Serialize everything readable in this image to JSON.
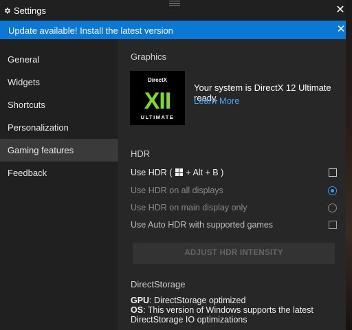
{
  "window": {
    "title": "Settings"
  },
  "banner": {
    "text": "Update available! Install the latest version"
  },
  "sidebar": {
    "items": [
      {
        "label": "General"
      },
      {
        "label": "Widgets"
      },
      {
        "label": "Shortcuts"
      },
      {
        "label": "Personalization"
      },
      {
        "label": "Gaming features",
        "active": true
      },
      {
        "label": "Feedback"
      }
    ]
  },
  "graphics": {
    "heading": "Graphics",
    "logo": {
      "top": "DirectX",
      "mark": "XII",
      "bottom": "ULTIMATE"
    },
    "status": "Your system is DirectX 12 Ultimate ready.",
    "learn_more": "Learn More"
  },
  "hdr": {
    "heading": "HDR",
    "use_hdr": {
      "label_prefix": "Use HDR (",
      "label_suffix": "+ Alt + B )",
      "checked": false
    },
    "all_displays": {
      "label": "Use HDR on all displays",
      "selected": true
    },
    "main_display": {
      "label": "Use HDR on main display only",
      "selected": false
    },
    "auto_hdr": {
      "label": "Use Auto HDR with supported games",
      "checked": false
    },
    "adjust_button": "ADJUST HDR INTENSITY"
  },
  "directstorage": {
    "heading": "DirectStorage",
    "gpu_label": "GPU",
    "gpu_value": ": DirectStorage optimized",
    "os_label": "OS",
    "os_value": ": This version of Windows supports the latest",
    "os_value_2": "DirectStorage IO optimizations"
  },
  "colors": {
    "accent": "#0a78d4",
    "link": "#4aa3ee",
    "dx_green": "#7ddc1f",
    "background": "#272727",
    "sidebar": "#202020"
  }
}
